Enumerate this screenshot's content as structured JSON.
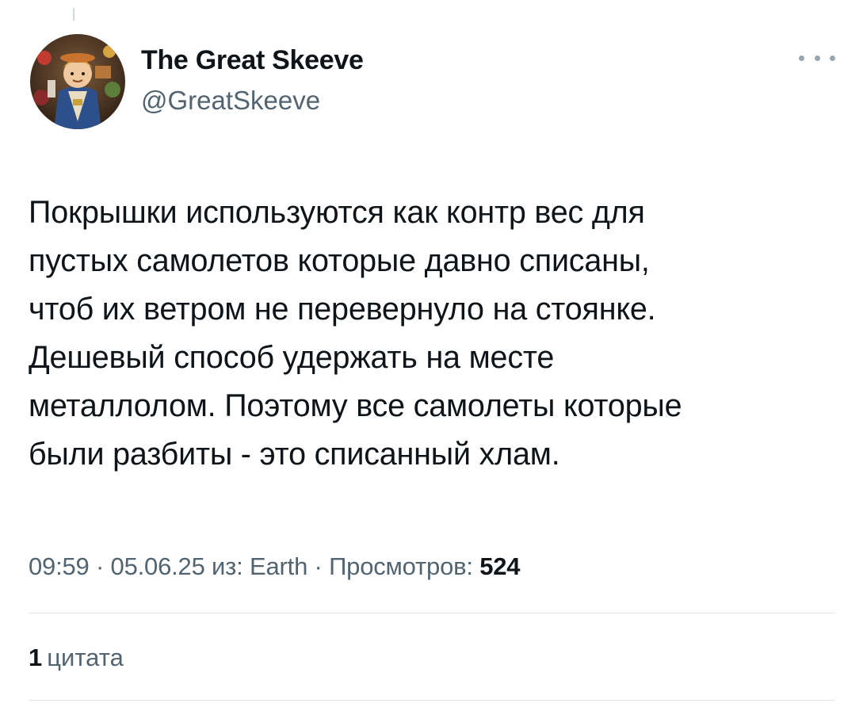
{
  "author": {
    "display_name": "The Great Skeeve",
    "handle": "@GreatSkeeve"
  },
  "tweet": {
    "text": "Покрышки используются как контр вес для\nпустых самолетов которые давно списаны,\nчтоб их ветром не перевернуло на стоянке.\nДешевый способ удержать на месте\nметаллолом. Поэтому все самолеты которые\nбыли разбиты - это списанный хлам."
  },
  "meta": {
    "time": "09:59",
    "separator": "·",
    "date": "05.06.25",
    "source_prefix": "из:",
    "source": "Earth",
    "views_label": "Просмотров:",
    "views_count": "524"
  },
  "stats": {
    "quotes_count": "1",
    "quotes_label": "цитата"
  },
  "icons": {
    "more": "more-horizontal-icon"
  },
  "colors": {
    "text_primary": "#0f1419",
    "text_secondary": "#536471",
    "divider": "#e1e6ea"
  }
}
